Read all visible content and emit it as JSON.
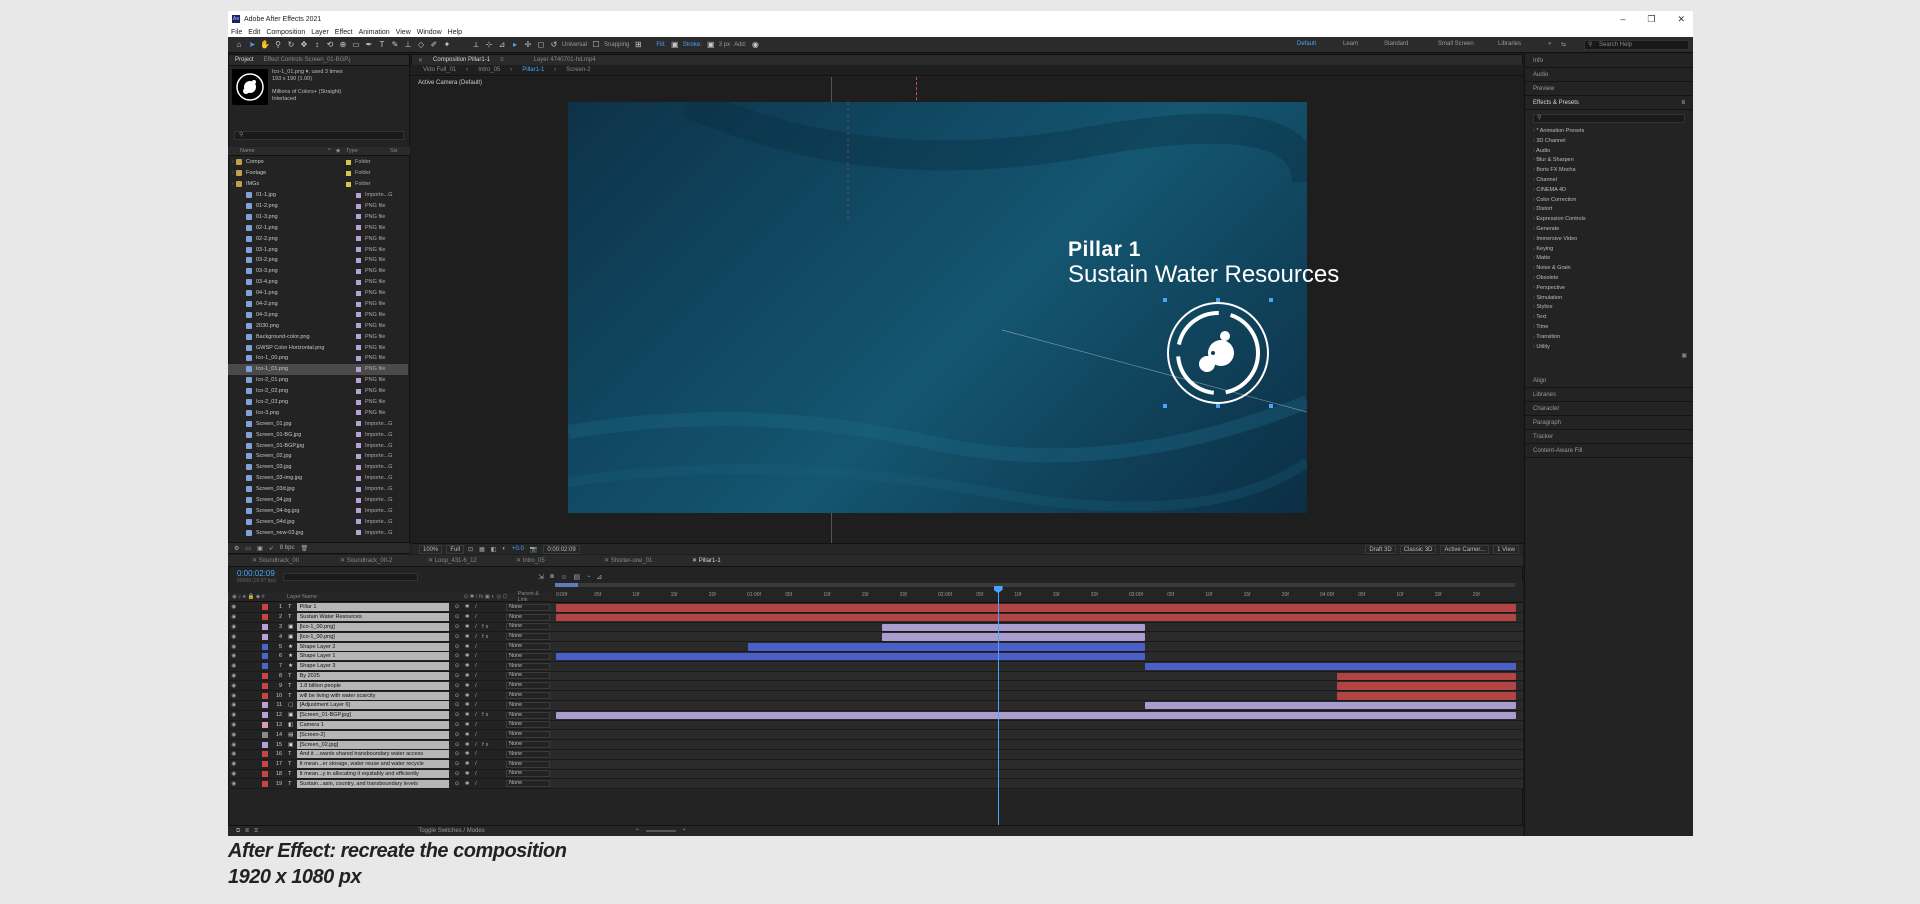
{
  "window": {
    "title": "Adobe After Effects 2021"
  },
  "menu": [
    "File",
    "Edit",
    "Composition",
    "Layer",
    "Effect",
    "Animation",
    "View",
    "Window",
    "Help"
  ],
  "toolbar": {
    "universal": "Universal",
    "snapping": "Snapping",
    "fill": "Fill:",
    "stroke": "Stroke:",
    "stroke_px": "3 px",
    "add": "Add:",
    "workspaces": [
      "Default",
      "Learn",
      "Standard",
      "Small Screen",
      "Libraries"
    ],
    "search_placeholder": "Search Help"
  },
  "project": {
    "tabs": [
      "Project",
      "Effect Controls  Screen_01-BGP.j"
    ],
    "selected_name": "Ico-1_01.png ▾, used 3 times",
    "selected_dims": "193 x 190 (1.00)",
    "selected_colors": "Millions of Colors+ (Straight)",
    "selected_interlace": "Interlaced",
    "search_placeholder": "",
    "col_name": "Name",
    "col_type": "Type",
    "col_size": "Siz",
    "bpc": "8 bpc",
    "items": [
      {
        "name": "Compo",
        "type": "Folder",
        "icon": "folder",
        "label": "#d9c44a"
      },
      {
        "name": "Footage",
        "type": "Folder",
        "icon": "folder",
        "label": "#d9c44a"
      },
      {
        "name": "IMGs",
        "type": "Folder",
        "icon": "folder",
        "label": "#d9c44a"
      },
      {
        "name": "01-1.jpg",
        "type": "Importe...G",
        "icon": "file",
        "label": "#b4a2d6"
      },
      {
        "name": "01-2.png",
        "type": "PNG file",
        "icon": "file",
        "label": "#b4a2d6"
      },
      {
        "name": "01-3.png",
        "type": "PNG file",
        "icon": "file",
        "label": "#b4a2d6"
      },
      {
        "name": "02-1.png",
        "type": "PNG file",
        "icon": "file",
        "label": "#b4a2d6"
      },
      {
        "name": "02-2.png",
        "type": "PNG file",
        "icon": "file",
        "label": "#b4a2d6"
      },
      {
        "name": "03-1.png",
        "type": "PNG file",
        "icon": "file",
        "label": "#b4a2d6"
      },
      {
        "name": "03-2.png",
        "type": "PNG file",
        "icon": "file",
        "label": "#b4a2d6"
      },
      {
        "name": "03-3.png",
        "type": "PNG file",
        "icon": "file",
        "label": "#b4a2d6"
      },
      {
        "name": "03-4.png",
        "type": "PNG file",
        "icon": "file",
        "label": "#b4a2d6"
      },
      {
        "name": "04-1.png",
        "type": "PNG file",
        "icon": "file",
        "label": "#b4a2d6"
      },
      {
        "name": "04-2.png",
        "type": "PNG file",
        "icon": "file",
        "label": "#b4a2d6"
      },
      {
        "name": "04-3.png",
        "type": "PNG file",
        "icon": "file",
        "label": "#b4a2d6"
      },
      {
        "name": "2030.png",
        "type": "PNG file",
        "icon": "file",
        "label": "#b4a2d6"
      },
      {
        "name": "Background-color.png",
        "type": "PNG file",
        "icon": "file",
        "label": "#b4a2d6"
      },
      {
        "name": "GWSP Color Horizontal.png",
        "type": "PNG file",
        "icon": "file",
        "label": "#b4a2d6"
      },
      {
        "name": "Ico-1_00.png",
        "type": "PNG file",
        "icon": "file",
        "label": "#b4a2d6"
      },
      {
        "name": "Ico-1_01.png",
        "type": "PNG file",
        "icon": "file",
        "label": "#b4a2d6",
        "selected": true
      },
      {
        "name": "Ico-2_01.png",
        "type": "PNG file",
        "icon": "file",
        "label": "#b4a2d6"
      },
      {
        "name": "Ico-2_02.png",
        "type": "PNG file",
        "icon": "file",
        "label": "#b4a2d6"
      },
      {
        "name": "Ico-2_03.png",
        "type": "PNG file",
        "icon": "file",
        "label": "#b4a2d6"
      },
      {
        "name": "Ico-3.png",
        "type": "PNG file",
        "icon": "file",
        "label": "#b4a2d6"
      },
      {
        "name": "Screen_01.jpg",
        "type": "Importe...G",
        "icon": "file",
        "label": "#b4a2d6"
      },
      {
        "name": "Screen_01-BG.jpg",
        "type": "Importe...G",
        "icon": "file",
        "label": "#b4a2d6"
      },
      {
        "name": "Screen_01-BGP.jpg",
        "type": "Importe...G",
        "icon": "file",
        "label": "#b4a2d6"
      },
      {
        "name": "Screen_02.jpg",
        "type": "Importe...G",
        "icon": "file",
        "label": "#b4a2d6"
      },
      {
        "name": "Screen_03.jpg",
        "type": "Importe...G",
        "icon": "file",
        "label": "#b4a2d6"
      },
      {
        "name": "Screen_03-img.jpg",
        "type": "Importe...G",
        "icon": "file",
        "label": "#b4a2d6"
      },
      {
        "name": "Screen_03d.jpg",
        "type": "Importe...G",
        "icon": "file",
        "label": "#b4a2d6"
      },
      {
        "name": "Screen_04.jpg",
        "type": "Importe...G",
        "icon": "file",
        "label": "#b4a2d6"
      },
      {
        "name": "Screen_04-bg.jpg",
        "type": "Importe...G",
        "icon": "file",
        "label": "#b4a2d6"
      },
      {
        "name": "Screen_04d.jpg",
        "type": "Importe...G",
        "icon": "file",
        "label": "#b4a2d6"
      },
      {
        "name": "Screen_new-03.jpg",
        "type": "Importe...G",
        "icon": "file",
        "label": "#b4a2d6"
      }
    ]
  },
  "composition": {
    "tab_comp": "Composition  Pillar1-1",
    "tab_layer": "Layer  4740701-hd.mp4",
    "subtabs": [
      "Vido Full_01",
      "Intro_05",
      "Pillar1-1",
      "Screen-2"
    ],
    "active_subtab": "Pillar1-1",
    "camera_label": "Active Camera (Default)",
    "canvas_title": "Pillar 1",
    "canvas_subtitle": "Sustain Water Resources",
    "zoom": "100%",
    "resolution": "Full",
    "exposure": "+0.0",
    "timecode": "0:00:02:09",
    "draft3d": "Draft 3D",
    "renderer": "Classic 3D",
    "camera_select": "Active Camer...",
    "views": "1 View"
  },
  "right_panels": {
    "top": [
      "Info",
      "Audio",
      "Preview"
    ],
    "effects_title": "Effects & Presets",
    "effects": [
      "* Animation Presets",
      "3D Channel",
      "Audio",
      "Blur & Sharpen",
      "Boris FX Mocha",
      "Channel",
      "CINEMA 4D",
      "Color Correction",
      "Distort",
      "Expression Controls",
      "Generate",
      "Immersive Video",
      "Keying",
      "Matte",
      "Noise & Grain",
      "Obsolete",
      "Perspective",
      "Simulation",
      "Stylize",
      "Text",
      "Time",
      "Transition",
      "Utility"
    ],
    "bottom": [
      "Align",
      "Libraries",
      "Character",
      "Paragraph",
      "Tracker",
      "Content-Aware Fill"
    ]
  },
  "timeline": {
    "tabs": [
      "Soundtrack_0II",
      "Soundtrack_0II-2",
      "Loop_431-6_12",
      "Intro_05",
      "Shorter-one_01",
      "Pillar1-1"
    ],
    "active_tab": "Pillar1-1",
    "timecode": "0:00:02:09",
    "timecode_sub": "00069 (29.97 fps)",
    "col_layer_name": "Layer Name",
    "col_parent": "Parent & Link",
    "toggle_label": "Toggle Switches / Modes",
    "ruler": [
      "0:00f",
      "05f",
      "10f",
      "15f",
      "20f",
      "01:00f",
      "05f",
      "10f",
      "15f",
      "20f",
      "02:00f",
      "05f",
      "10f",
      "15f",
      "20f",
      "03:00f",
      "05f",
      "10f",
      "15f",
      "20f",
      "04:00f",
      "05f",
      "10f",
      "15f",
      "20f"
    ],
    "playhead_seconds": 2.3,
    "duration_seconds": 5.0,
    "layers": [
      {
        "num": "1",
        "name": "Pillar 1",
        "label": "#c94444",
        "icon": "T",
        "start": 0.0,
        "end": 5.0,
        "bar": "#b34444"
      },
      {
        "num": "2",
        "name": "Sustain Water Resources",
        "label": "#c94444",
        "icon": "T",
        "start": 0.0,
        "end": 5.0,
        "bar": "#b34444"
      },
      {
        "num": "3",
        "name": "[Ico-1_00.png]",
        "label": "#b4a2d6",
        "icon": "▣",
        "start": 1.7,
        "end": 3.07,
        "bar": "#a99dd0"
      },
      {
        "num": "4",
        "name": "[Ico-1_00.png]",
        "label": "#b4a2d6",
        "icon": "▣",
        "start": 1.7,
        "end": 3.07,
        "bar": "#a99dd0"
      },
      {
        "num": "5",
        "name": "Shape Layer 2",
        "label": "#4a66cc",
        "icon": "★",
        "start": 1.0,
        "end": 3.07,
        "bar": "#4a5fc8"
      },
      {
        "num": "6",
        "name": "Shape Layer 1",
        "label": "#4a66cc",
        "icon": "★",
        "start": 0.0,
        "end": 3.07,
        "bar": "#4a5fc8"
      },
      {
        "num": "7",
        "name": "Shape Layer 3",
        "label": "#4a66cc",
        "icon": "★",
        "start": 3.07,
        "end": 5.0,
        "bar": "#4a5fc8"
      },
      {
        "num": "8",
        "name": "By 2025",
        "label": "#c94444",
        "icon": "T",
        "start": 4.07,
        "end": 5.0,
        "bar": "#b34444"
      },
      {
        "num": "9",
        "name": "1.8 billion people",
        "label": "#c94444",
        "icon": "T",
        "start": 4.07,
        "end": 5.0,
        "bar": "#b34444"
      },
      {
        "num": "10",
        "name": "will be living with water scarcity",
        "label": "#c94444",
        "icon": "T",
        "start": 4.07,
        "end": 5.0,
        "bar": "#b34444"
      },
      {
        "num": "11",
        "name": "[Adjustment Layer 6]",
        "label": "#b4a2d6",
        "icon": "▢",
        "start": 3.07,
        "end": 5.0,
        "bar": "#a99dd0"
      },
      {
        "num": "12",
        "name": "[Screen_01-BGP.jpg]",
        "label": "#b4a2d6",
        "icon": "▣",
        "start": 0.0,
        "end": 5.0,
        "bar": "#a99dd0"
      },
      {
        "num": "13",
        "name": "Camera 1",
        "label": "#d69ea8",
        "icon": "◧",
        "start": null,
        "end": null,
        "bar": ""
      },
      {
        "num": "14",
        "name": "[Screen-2]",
        "label": "#8a8a8a",
        "icon": "▤",
        "start": null,
        "end": null,
        "bar": ""
      },
      {
        "num": "15",
        "name": "[Screen_02.jpg]",
        "label": "#b4a2d6",
        "icon": "▣",
        "start": null,
        "end": null,
        "bar": ""
      },
      {
        "num": "16",
        "name": "And it ...wards shared transboundary water access",
        "label": "#c94444",
        "icon": "T",
        "start": null,
        "end": null,
        "bar": ""
      },
      {
        "num": "17",
        "name": "It mean...er storage, water reuse and water recycle",
        "label": "#c94444",
        "icon": "T",
        "start": null,
        "end": null,
        "bar": ""
      },
      {
        "num": "18",
        "name": "It mean...y in allocating it equitably and efficiently",
        "label": "#c94444",
        "icon": "T",
        "start": null,
        "end": null,
        "bar": ""
      },
      {
        "num": "19",
        "name": "Sustain...asin, country, and transboundary levels",
        "label": "#c94444",
        "icon": "T",
        "start": null,
        "end": null,
        "bar": ""
      }
    ],
    "parent_value": "None"
  },
  "caption": {
    "line1": "After Effect: recreate the composition",
    "line2": "1920 x 1080 px"
  }
}
